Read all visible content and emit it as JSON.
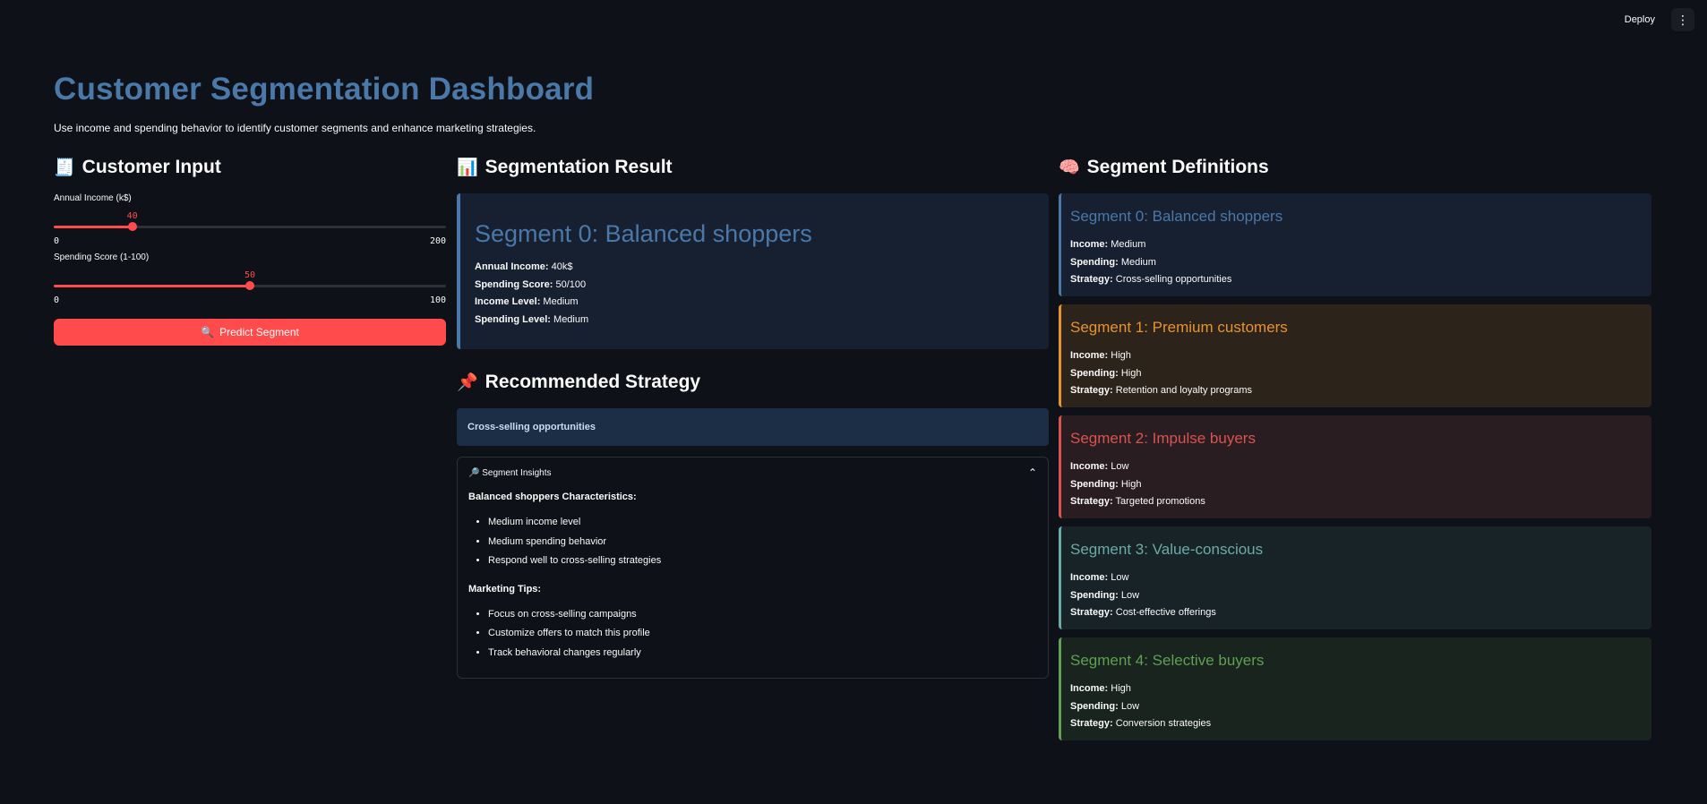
{
  "header": {
    "deploy_label": "Deploy",
    "menu_icon": "kebab-menu-icon"
  },
  "page": {
    "title": "Customer Segmentation Dashboard",
    "subtitle": "Use income and spending behavior to identify customer segments and enhance marketing strategies."
  },
  "input": {
    "heading": "Customer Input",
    "heading_emoji": "🧾",
    "income": {
      "label": "Annual Income (k$)",
      "value": 40,
      "value_text": "40",
      "min": "0",
      "max": "200",
      "fraction": 0.2
    },
    "spending": {
      "label": "Spending Score (1-100)",
      "value": 50,
      "value_text": "50",
      "min": "0",
      "max": "100",
      "fraction": 0.5
    },
    "predict_label": "Predict Segment",
    "predict_emoji": "🔍"
  },
  "result": {
    "heading": "Segmentation Result",
    "heading_emoji": "📊",
    "segment_title": "Segment 0: Balanced shoppers",
    "annual_income_key": "Annual Income:",
    "annual_income_val": "40k$",
    "spending_score_key": "Spending Score:",
    "spending_score_val": "50/100",
    "income_level_key": "Income Level:",
    "income_level_val": "Medium",
    "spending_level_key": "Spending Level:",
    "spending_level_val": "Medium"
  },
  "strategy": {
    "heading": "Recommended Strategy",
    "heading_emoji": "📌",
    "text": "Cross-selling opportunities"
  },
  "insights": {
    "label": "Segment Insights",
    "emoji": "🔎",
    "characteristics_title": "Balanced shoppers Characteristics:",
    "characteristics": [
      "Medium income level",
      "Medium spending behavior",
      "Respond well to cross-selling strategies"
    ],
    "tips_title": "Marketing Tips:",
    "tips": [
      "Focus on cross-selling campaigns",
      "Customize offers to match this profile",
      "Track behavioral changes regularly"
    ]
  },
  "definitions": {
    "heading": "Segment Definitions",
    "heading_emoji": "🧠",
    "income_key": "Income:",
    "spending_key": "Spending:",
    "strategy_key": "Strategy:",
    "segments": [
      {
        "title": "Segment 0: Balanced shoppers",
        "income": "Medium",
        "spending": "Medium",
        "strategy": "Cross-selling opportunities",
        "color": "#4a78a8",
        "bg": "#172030"
      },
      {
        "title": "Segment 1: Premium customers",
        "income": "High",
        "spending": "High",
        "strategy": "Retention and loyalty programs",
        "color": "#e8922f",
        "bg": "#2c241a"
      },
      {
        "title": "Segment 2: Impulse buyers",
        "income": "Low",
        "spending": "High",
        "strategy": "Targeted promotions",
        "color": "#d9534f",
        "bg": "#2a1d22"
      },
      {
        "title": "Segment 3: Value-conscious",
        "income": "Low",
        "spending": "Low",
        "strategy": "Cost-effective offerings",
        "color": "#6aaba6",
        "bg": "#182328"
      },
      {
        "title": "Segment 4: Selective buyers",
        "income": "High",
        "spending": "Low",
        "strategy": "Conversion strategies",
        "color": "#5fa052",
        "bg": "#18241d"
      }
    ]
  }
}
